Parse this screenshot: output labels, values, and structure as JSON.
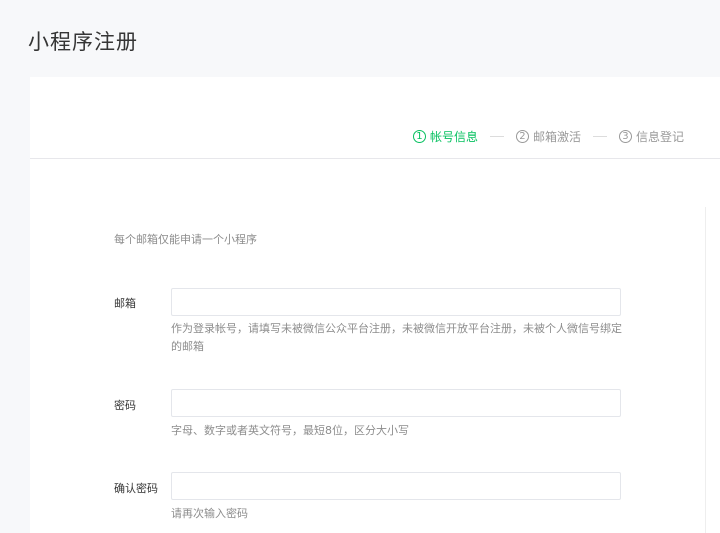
{
  "header": {
    "title": "小程序注册"
  },
  "steps": [
    {
      "num": "1",
      "label": "帐号信息",
      "active": true
    },
    {
      "num": "2",
      "label": "邮箱激活",
      "active": false
    },
    {
      "num": "3",
      "label": "信息登记",
      "active": false
    }
  ],
  "form": {
    "hint": "每个邮箱仅能申请一个小程序",
    "email": {
      "label": "邮箱",
      "value": "",
      "tip": "作为登录帐号，请填写未被微信公众平台注册，未被微信开放平台注册，未被个人微信号绑定的邮箱"
    },
    "password": {
      "label": "密码",
      "value": "",
      "tip": "字母、数字或者英文符号，最短8位，区分大小写"
    },
    "confirm_password": {
      "label": "确认密码",
      "value": "",
      "tip": "请再次输入密码"
    }
  },
  "colors": {
    "accent": "#07c160",
    "inactive": "#9a9a9a"
  }
}
